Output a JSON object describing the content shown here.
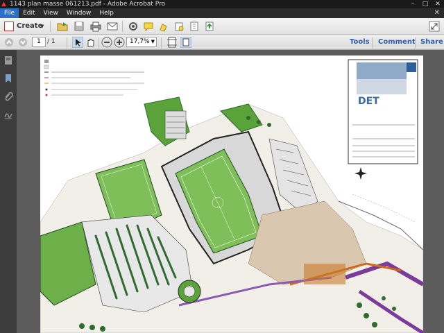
{
  "window": {
    "title": "1143 plan masse 061213.pdf - Adobe Acrobat Pro",
    "minimize": "–",
    "maximize": "□",
    "close": "✕"
  },
  "menu": {
    "items": [
      "File",
      "Edit",
      "View",
      "Window",
      "Help"
    ],
    "close": "✕"
  },
  "toolbar": {
    "create_label": "Create",
    "create_caret": "▼"
  },
  "nav": {
    "page_current": "1",
    "page_total": "/ 1",
    "zoom": "17,7%",
    "zoom_caret": "▼"
  },
  "panels": {
    "tools": "Tools",
    "comment": "Comment",
    "share": "Share"
  },
  "document": {
    "stamp": "DET"
  },
  "colors": {
    "menu_active": "#2a6fcb",
    "panel_link": "#2a5fa8",
    "field_green": "#7fbf5a",
    "grass_dark": "#2f6b2f",
    "path_purple": "#7a3b9a"
  }
}
